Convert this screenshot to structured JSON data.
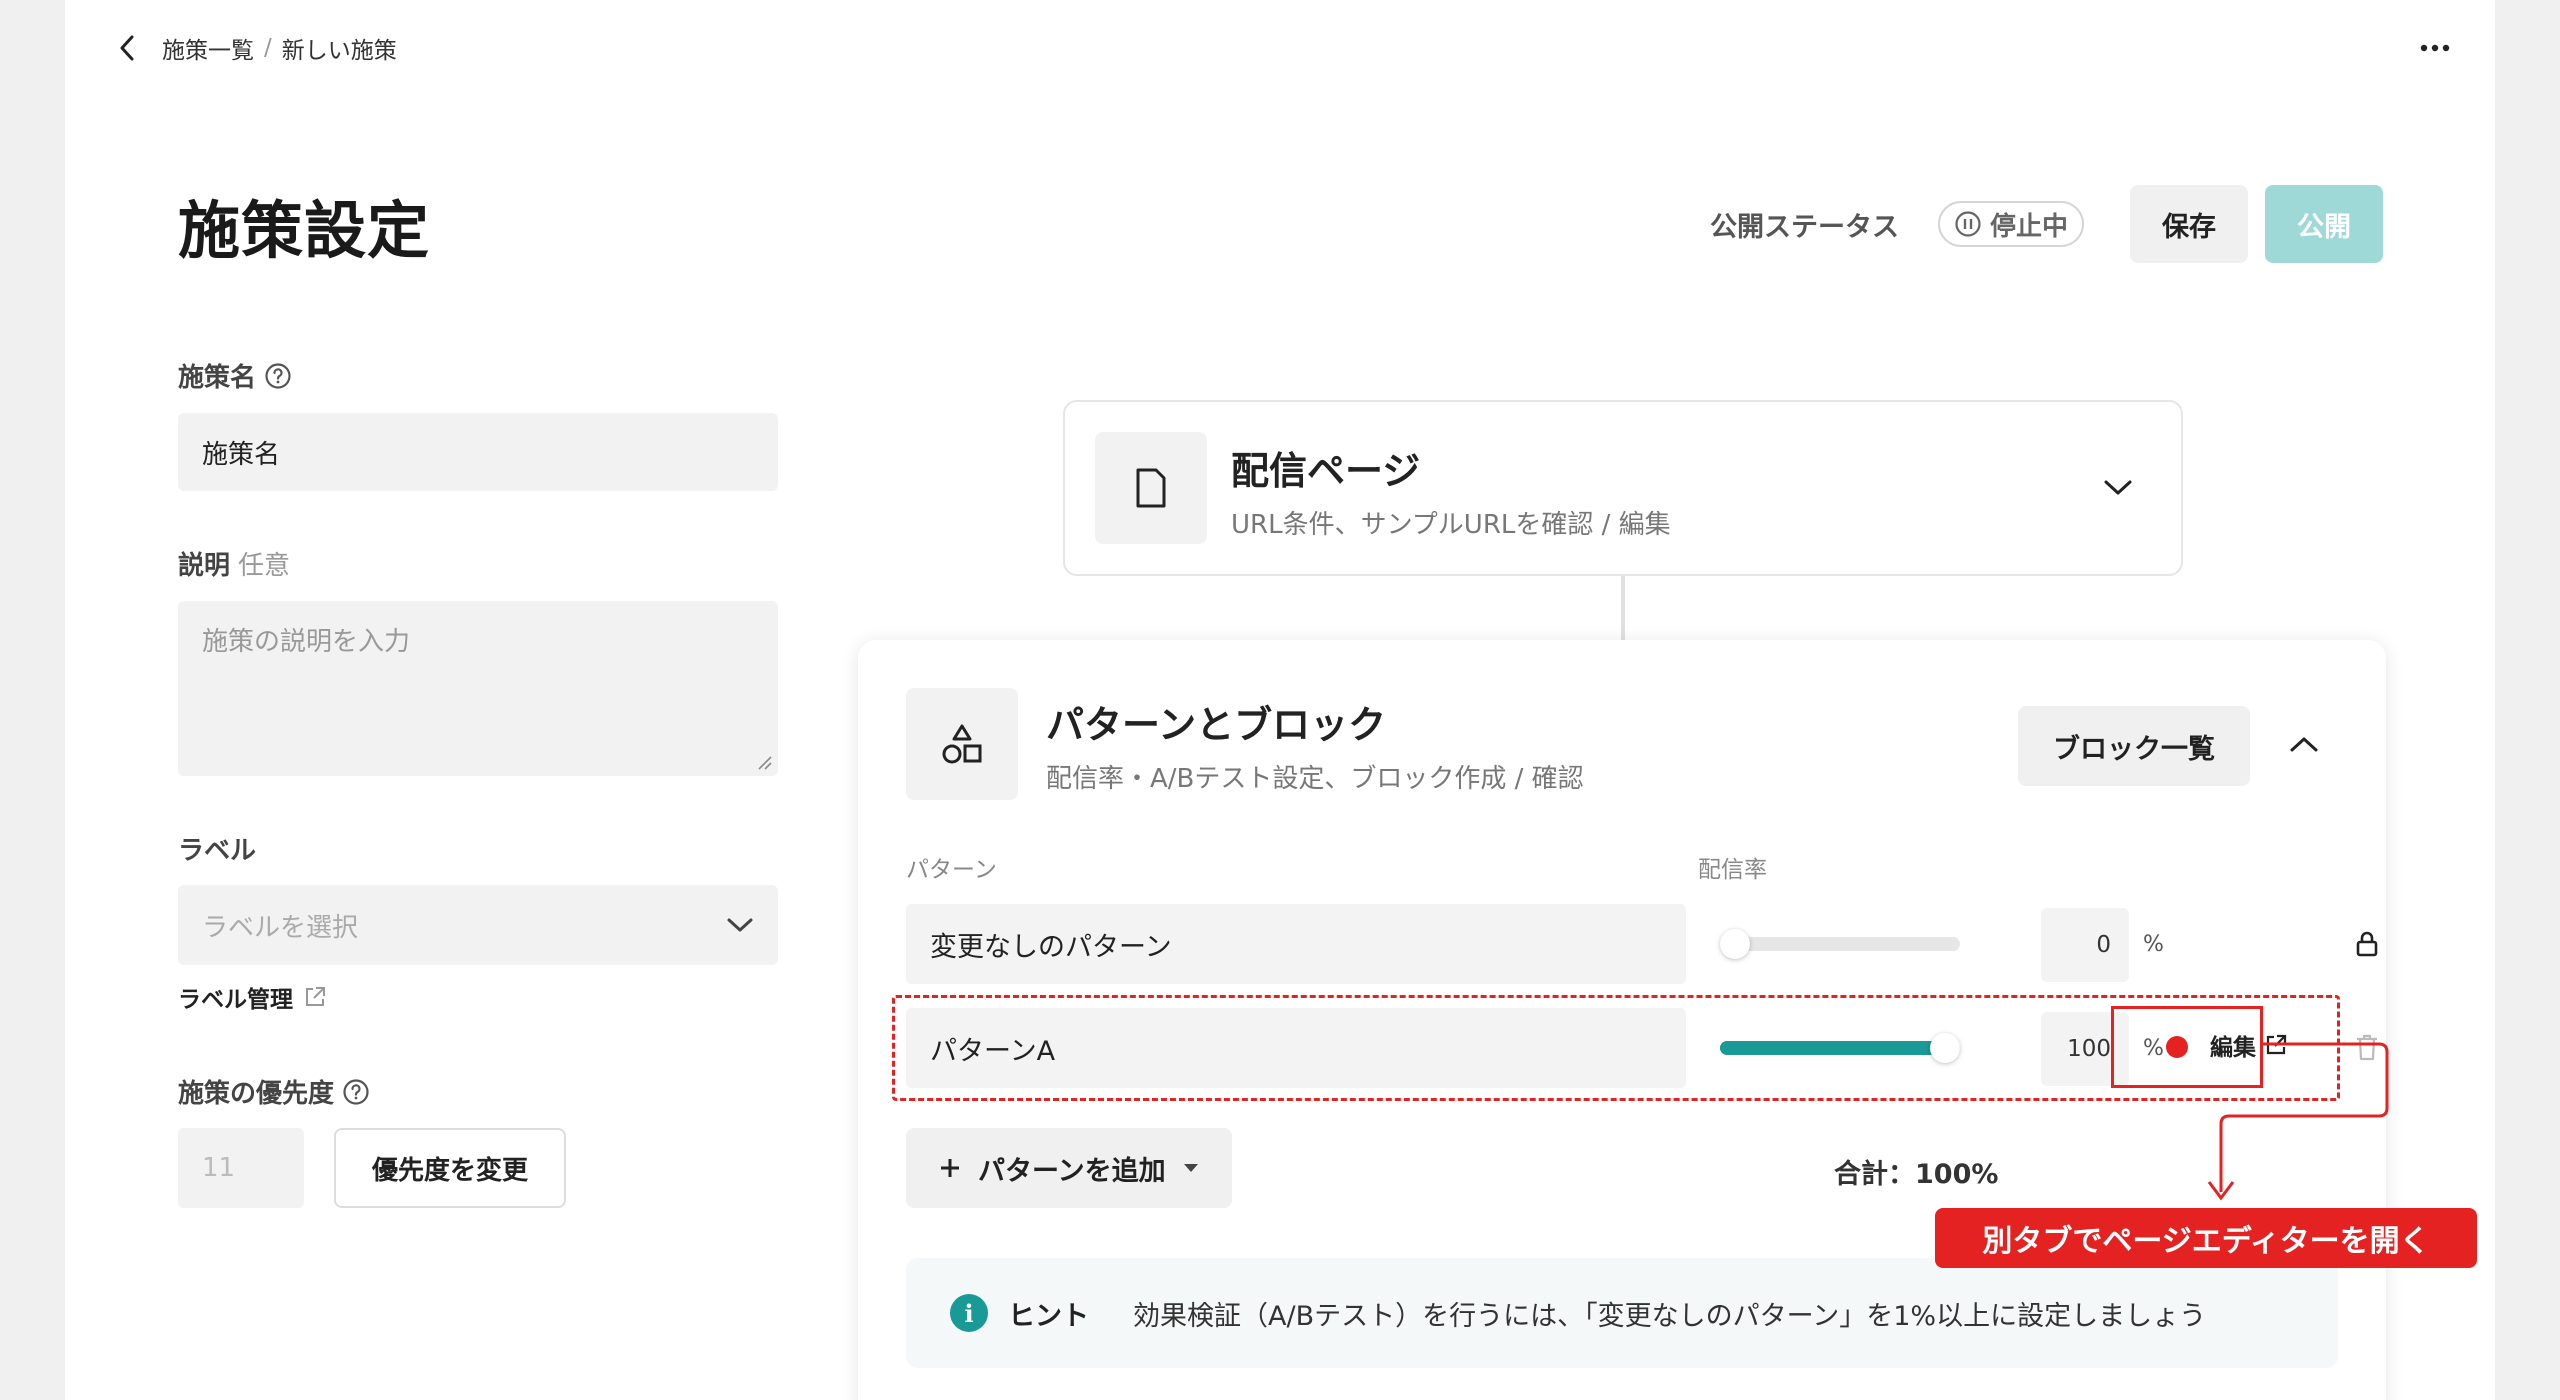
{
  "breadcrumb": {
    "parent": "施策一覧",
    "separator": "/",
    "current": "新しい施策"
  },
  "header": {
    "title": "施策設定",
    "status_label": "公開ステータス",
    "status_value": "停止中",
    "save_label": "保存",
    "publish_label": "公開"
  },
  "form": {
    "name_label": "施策名",
    "name_value": "施策名",
    "desc_label": "説明",
    "desc_optional": "任意",
    "desc_placeholder": "施策の説明を入力",
    "label_label": "ラベル",
    "label_placeholder": "ラベルを選択",
    "label_manage": "ラベル管理",
    "priority_label": "施策の優先度",
    "priority_value": "11",
    "priority_button": "優先度を変更"
  },
  "delivery": {
    "title": "配信ページ",
    "subtitle": "URL条件、サンプルURLを確認 / 編集"
  },
  "patterns": {
    "title": "パターンとブロック",
    "subtitle": "配信率・A/Bテスト設定、ブロック作成 / 確認",
    "block_list_button": "ブロック一覧",
    "col_pattern": "パターン",
    "col_rate": "配信率",
    "rows": [
      {
        "name": "変更なしのパターン",
        "rate": "0",
        "rate_fraction": 0.0,
        "unit": "%"
      },
      {
        "name": "パターンA",
        "rate": "100",
        "rate_fraction": 1.0,
        "unit": "%",
        "edit_label": "編集"
      }
    ],
    "add_button": "パターンを追加",
    "total": "合計：100%"
  },
  "hint": {
    "title": "ヒント",
    "text": "効果検証（A/Bテスト）を行うには、「変更なしのパターン」を1%以上に設定しましょう"
  },
  "annotation": {
    "callout": "別タブでページエディターを開く"
  },
  "colors": {
    "accent": "#1a9a96",
    "publish_disabled": "#9fd9d7",
    "annotation": "#e52222"
  }
}
